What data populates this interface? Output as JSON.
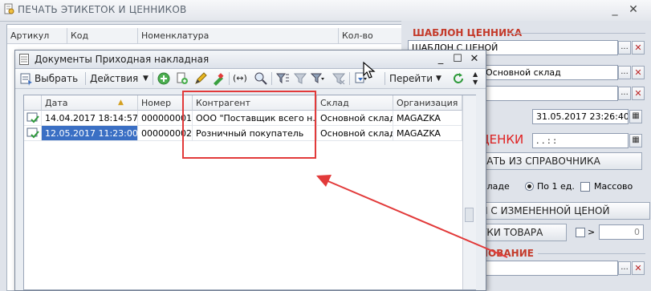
{
  "main_window": {
    "title": "ПЕЧАТЬ ЭТИКЕТОК И ЦЕННИКОВ",
    "left_table_columns": [
      "Артикул",
      "Код",
      "Номенклатура",
      "Кол-во"
    ],
    "right_panel": {
      "template_section_title": "ШАБЛОН ЦЕННИКА",
      "template_value": "ШАБЛОН С ЦЕНОЙ",
      "warehouse_value": "Основной склад",
      "empty_field_value": "",
      "date_label": "м",
      "date_value": "31.05.2017 23:26:40",
      "prices_label": "ЦЕНКИ",
      "prices_value": ". . :  :",
      "pick_button": "РАТЬ ИЗ СПРАВОЧНИКА",
      "radio_stock_label": "кладе",
      "radio_one_label": "По 1 ед.",
      "mass_label": "Массово",
      "changed_price_button": "Ы С ИЗМЕНЕННОЙ ЦЕНОЙ",
      "goods_button": "ТКИ ТОВАРА",
      "gt_label": ">",
      "gt_value": "0",
      "basis_section_title": "НОВАНИЕ"
    }
  },
  "dialog": {
    "title": "Документы Приходная накладная",
    "toolbar": {
      "select_label": "Выбрать",
      "actions_label": "Действия",
      "goto_label": "Перейти"
    },
    "columns": [
      "Дата",
      "Номер",
      "Контрагент",
      "Склад",
      "Организация"
    ],
    "rows": [
      {
        "date": "14.04.2017 18:14:57",
        "number": "000000001",
        "counterparty": "ООО \"Поставщик всего н...",
        "warehouse": "Основной склад",
        "org": "MAGAZKA"
      },
      {
        "date": "12.05.2017 11:23:00",
        "number": "000000002",
        "counterparty": "Розничный покупатель",
        "warehouse": "Основной склад",
        "org": "MAGAZKA"
      }
    ]
  },
  "colors": {
    "accent_red": "#e23a3a",
    "selection_blue": "#3a6fc4",
    "section_title_red": "#c43a2a"
  }
}
